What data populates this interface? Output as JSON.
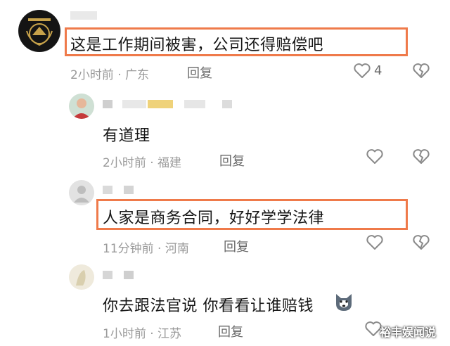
{
  "comments": [
    {
      "text": "这是工作期间被害，公司还得赔偿吧",
      "meta": "2小时前 · 广东",
      "reply": "回复",
      "likes": "4"
    },
    {
      "text": "有道理",
      "meta": "2小时前 · 福建",
      "reply": "回复"
    },
    {
      "text": "人家是商务合同，好好学学法律",
      "meta": "11分钟前 · 河南",
      "reply": "回复"
    },
    {
      "text": "你去跟法官说 你看看让谁赔钱",
      "meta": "1小时前 · 江苏",
      "reply": "回复"
    }
  ],
  "watermark": "裕丰娱闻说",
  "colors": {
    "highlight": "#ef7a4a",
    "meta": "#9a9a9a",
    "icon": "#8a8a8a"
  },
  "icons": [
    "heart-icon",
    "broken-heart-icon",
    "husky-emoji-icon",
    "avatar-icon"
  ]
}
